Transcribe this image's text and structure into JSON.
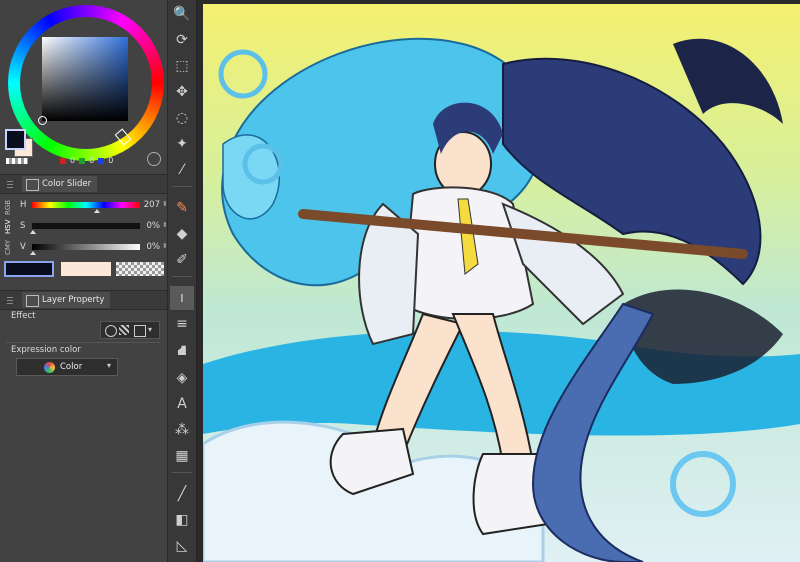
{
  "color_wheel": {
    "main_color": "#0a0e1c",
    "sub_color": "#fbe8d8",
    "rgb_readout": [
      {
        "channel": "r",
        "color": "#d02020",
        "value": "0"
      },
      {
        "channel": "g",
        "color": "#20a030",
        "value": "0"
      },
      {
        "channel": "b",
        "color": "#2040e0",
        "value": "0"
      }
    ]
  },
  "color_slider_panel": {
    "title": "Color Slider",
    "modes": [
      "RGB",
      "HSV",
      "CMY"
    ],
    "active_mode": "HSV",
    "sliders": [
      {
        "label": "H",
        "value": "207",
        "fraction": 0.575
      },
      {
        "label": "S",
        "value": "0%",
        "fraction": 0.0
      },
      {
        "label": "V",
        "value": "0%",
        "fraction": 0.0
      }
    ]
  },
  "layer_property_panel": {
    "title": "Layer Property",
    "effect_label": "Effect",
    "expression_color_label": "Expression color",
    "expression_color_value": "Color"
  },
  "toolbar": {
    "tools": [
      {
        "name": "zoom-tool",
        "glyph": "🔍"
      },
      {
        "name": "rotate-tool",
        "glyph": "⟳"
      },
      {
        "name": "object-tool",
        "glyph": "⬚"
      },
      {
        "name": "move-tool",
        "glyph": "✥"
      },
      {
        "name": "lasso-tool",
        "glyph": "◌"
      },
      {
        "name": "magic-wand-tool",
        "glyph": "✦"
      },
      {
        "name": "eyedropper-tool",
        "glyph": "⁄"
      },
      {
        "name": "pen-tool",
        "glyph": "✎",
        "accent": true
      },
      {
        "name": "eraser-tool",
        "glyph": "◆"
      },
      {
        "name": "pencil-tool",
        "glyph": "✐"
      },
      {
        "name": "brush-tool",
        "glyph": "ı",
        "active": true
      },
      {
        "name": "decoration-tool",
        "glyph": "≡"
      },
      {
        "name": "airbrush-tool",
        "glyph": "⛘"
      },
      {
        "name": "fill-tool",
        "glyph": "◈"
      },
      {
        "name": "text-tool",
        "glyph": "A"
      },
      {
        "name": "blend-tool",
        "glyph": "⁂"
      },
      {
        "name": "frame-tool",
        "glyph": "▦"
      },
      {
        "name": "line-tool",
        "glyph": "╱"
      },
      {
        "name": "gradient-tool",
        "glyph": "◧"
      },
      {
        "name": "figure-tool",
        "glyph": "◺"
      }
    ]
  }
}
